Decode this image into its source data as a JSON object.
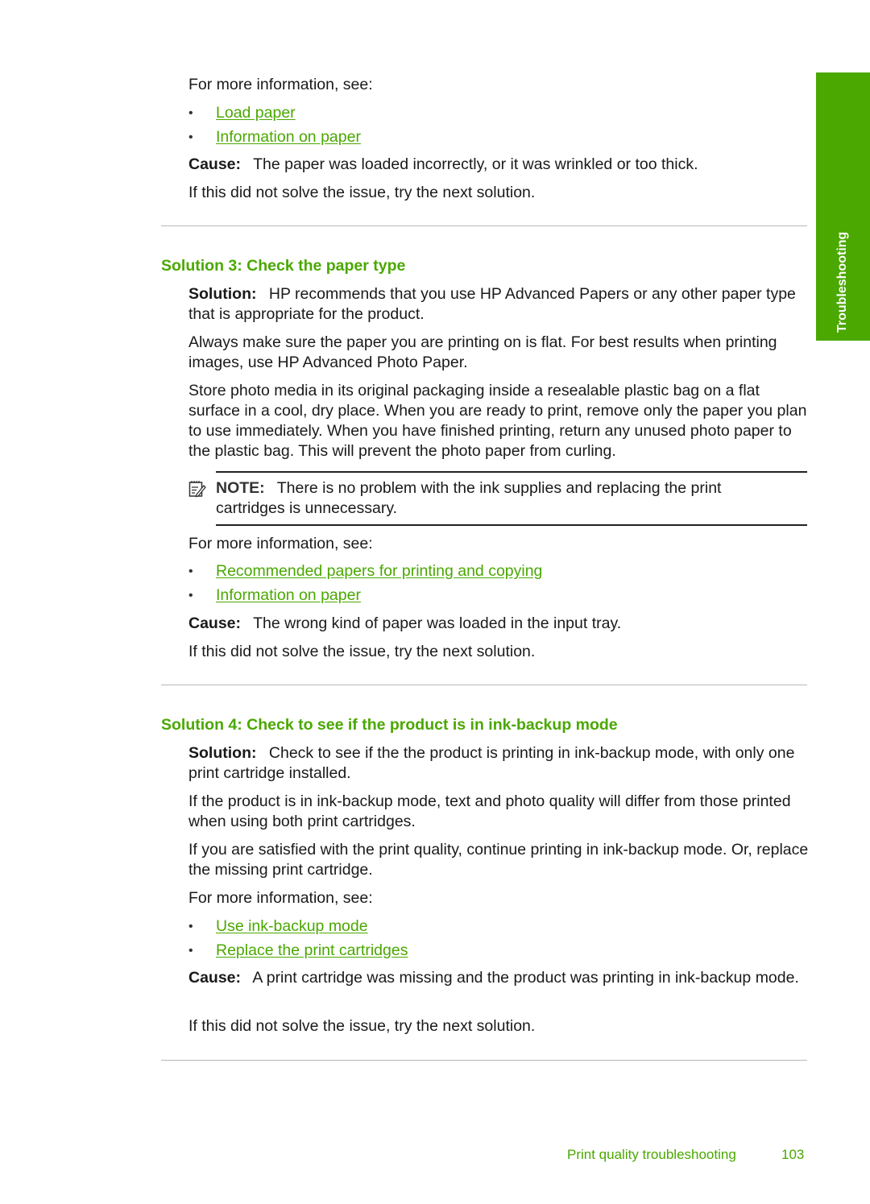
{
  "side_tab": {
    "label": "Troubleshooting"
  },
  "top_block": {
    "more_info": "For more information, see:",
    "links": [
      "Load paper",
      "Information on paper"
    ],
    "cause_label": "Cause:",
    "cause_text": "The paper was loaded incorrectly, or it was wrinkled or too thick.",
    "next": "If this did not solve the issue, try the next solution."
  },
  "solution3": {
    "heading": "Solution 3: Check the paper type",
    "solution_label": "Solution:",
    "solution_text": "HP recommends that you use HP Advanced Papers or any other paper type that is appropriate for the product.",
    "para1": "Always make sure the paper you are printing on is flat. For best results when printing images, use HP Advanced Photo Paper.",
    "para2": "Store photo media in its original packaging inside a resealable plastic bag on a flat surface in a cool, dry place. When you are ready to print, remove only the paper you plan to use immediately. When you have finished printing, return any unused photo paper to the plastic bag. This will prevent the photo paper from curling.",
    "note_label": "NOTE:",
    "note_text": "There is no problem with the ink supplies and replacing the print cartridges is unnecessary.",
    "more_info": "For more information, see:",
    "links": [
      "Recommended papers for printing and copying",
      "Information on paper"
    ],
    "cause_label": "Cause:",
    "cause_text": "The wrong kind of paper was loaded in the input tray.",
    "next": "If this did not solve the issue, try the next solution."
  },
  "solution4": {
    "heading": "Solution 4: Check to see if the product is in ink-backup mode",
    "solution_label": "Solution:",
    "solution_text": "Check to see if the the product is printing in ink-backup mode, with only one print cartridge installed.",
    "para1": "If the product is in ink-backup mode, text and photo quality will differ from those printed when using both print cartridges.",
    "para2": "If you are satisfied with the print quality, continue printing in ink-backup mode. Or, replace the missing print cartridge.",
    "more_info": "For more information, see:",
    "links": [
      "Use ink-backup mode",
      "Replace the print cartridges"
    ],
    "cause_label": "Cause:",
    "cause_text": "A print cartridge was missing and the product was printing in ink-backup mode.",
    "next": "If this did not solve the issue, try the next solution."
  },
  "footer": {
    "section": "Print quality troubleshooting",
    "page": "103"
  },
  "colors": {
    "accent": "#4aa800",
    "text": "#1a1a1a",
    "rule": "#b8b8b8"
  }
}
